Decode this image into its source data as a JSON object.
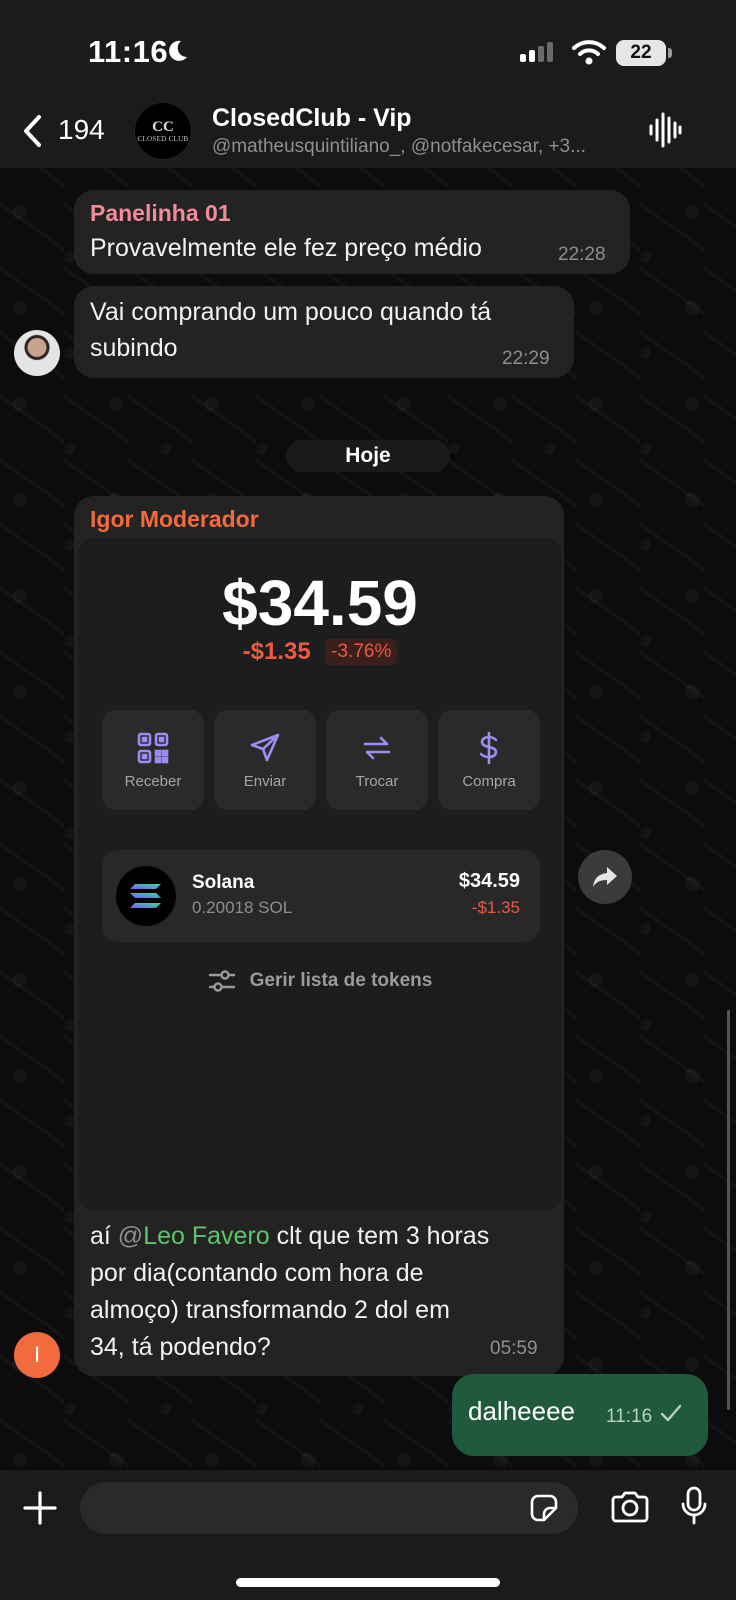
{
  "status_bar": {
    "time": "11:16",
    "battery": "22"
  },
  "header": {
    "back_count": "194",
    "group_name": "ClosedClub - Vip",
    "members": "@matheusquintiliano_, @notfakecesar, +3...",
    "avatar_logo": "CC",
    "avatar_text": "CLOSED CLUB"
  },
  "messages": [
    {
      "sender": "Panelinha 01",
      "sender_color": "#f48b9a",
      "text": "Provavelmente ele fez preço médio",
      "time": "22:28"
    },
    {
      "text_line1": "Vai comprando um pouco quando tá",
      "text_line2": "subindo",
      "time": "22:29"
    }
  ],
  "date_separator": "Hoje",
  "wallet_message": {
    "sender": "Igor Moderador",
    "sender_color": "#f26a3d",
    "avatar_initial": "I",
    "wallet": {
      "balance": "$34.59",
      "change": "-$1.35",
      "change_pct": "-3.76%",
      "actions": [
        "Receber",
        "Enviar",
        "Trocar",
        "Compra"
      ],
      "token": {
        "name": "Solana",
        "amount": "0.20018 SOL",
        "value": "$34.59",
        "change": "-$1.35"
      },
      "manage_label": "Gerir lista de tokens"
    },
    "caption_prefix": "aí ",
    "mention_at": "@",
    "mention_name": "Leo Favero",
    "caption_line1_rest": " clt que tem 3 horas",
    "caption_line2": "por dia(contando com hora de",
    "caption_line3": "almoço) transformando 2 dol em",
    "caption_line4": "34, tá podendo?",
    "time": "05:59"
  },
  "outgoing": {
    "text": "dalheeee",
    "time": "11:16"
  },
  "input": {
    "placeholder": ""
  },
  "icons": [
    "back-chevron-icon",
    "voice-chat-icon",
    "qr-icon",
    "send-icon",
    "swap-icon",
    "dollar-icon",
    "solana-icon",
    "sliders-icon",
    "forward-icon",
    "check-icon",
    "plus-icon",
    "sticker-icon",
    "camera-icon",
    "mic-icon"
  ]
}
